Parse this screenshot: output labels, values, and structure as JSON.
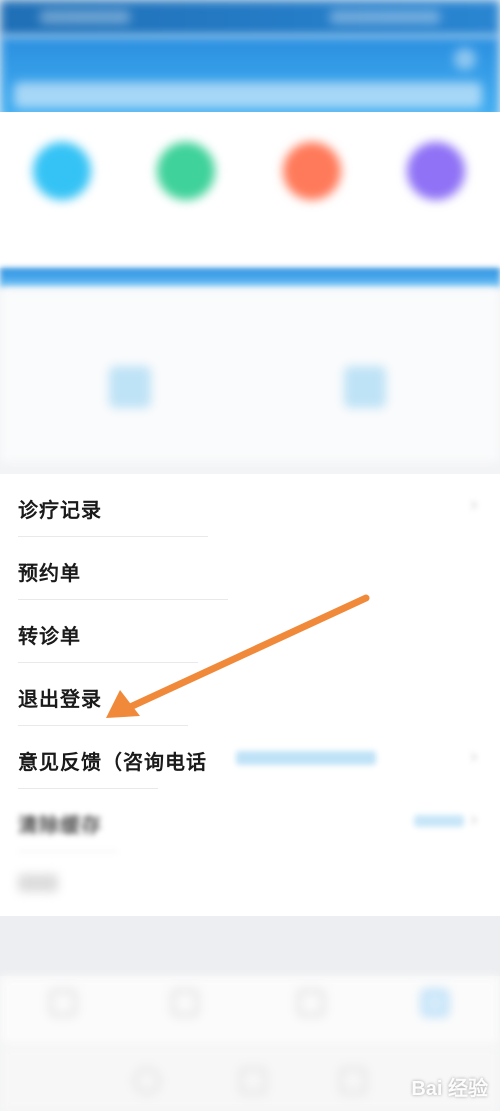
{
  "colors": {
    "header_start": "#2a8fe0",
    "header_end": "#44b0f2",
    "qa_blue": "#35c3f5",
    "qa_green": "#3fd29a",
    "qa_orange": "#ff7a5a",
    "qa_purple": "#8f72f6",
    "annotation_arrow": "#f08a3a",
    "value_blue": "#5ab2ec"
  },
  "menu": {
    "items": [
      {
        "label": "诊疗记录"
      },
      {
        "label": "预约单"
      },
      {
        "label": "转诊单"
      },
      {
        "label": "退出登录"
      },
      {
        "label": "意见反馈（咨询电话"
      },
      {
        "label": "清除缓存"
      }
    ]
  },
  "icons": {
    "header": "message-icon",
    "menu_chevron": "chevron-right-icon",
    "annotation": "arrow-pointer-icon"
  },
  "watermark": {
    "text": "Bai 经验"
  }
}
